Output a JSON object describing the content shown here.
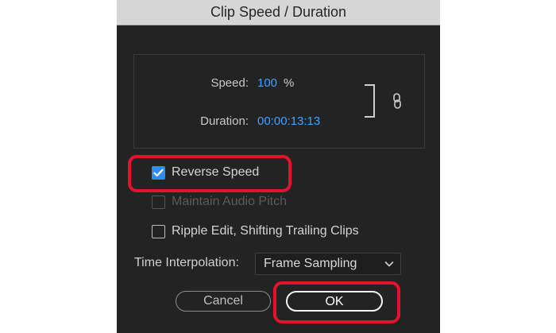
{
  "dialog": {
    "title": "Clip Speed / Duration"
  },
  "speed": {
    "label": "Speed:",
    "value": "100",
    "unit": "%"
  },
  "duration": {
    "label": "Duration:",
    "value": "00:00:13:13"
  },
  "link": {
    "icon": "link-icon"
  },
  "options": {
    "reverse_speed": {
      "label": "Reverse Speed",
      "checked": true
    },
    "maintain_audio_pitch": {
      "label": "Maintain Audio Pitch",
      "checked": false,
      "disabled": true
    },
    "ripple_edit": {
      "label": "Ripple Edit, Shifting Trailing Clips",
      "checked": false
    }
  },
  "time_interpolation": {
    "label": "Time Interpolation:",
    "value": "Frame Sampling"
  },
  "buttons": {
    "cancel": "Cancel",
    "ok": "OK"
  },
  "colors": {
    "accent": "#3ea3ff",
    "highlight": "#e8112d",
    "checkbox_checked": "#2f8cf0"
  }
}
